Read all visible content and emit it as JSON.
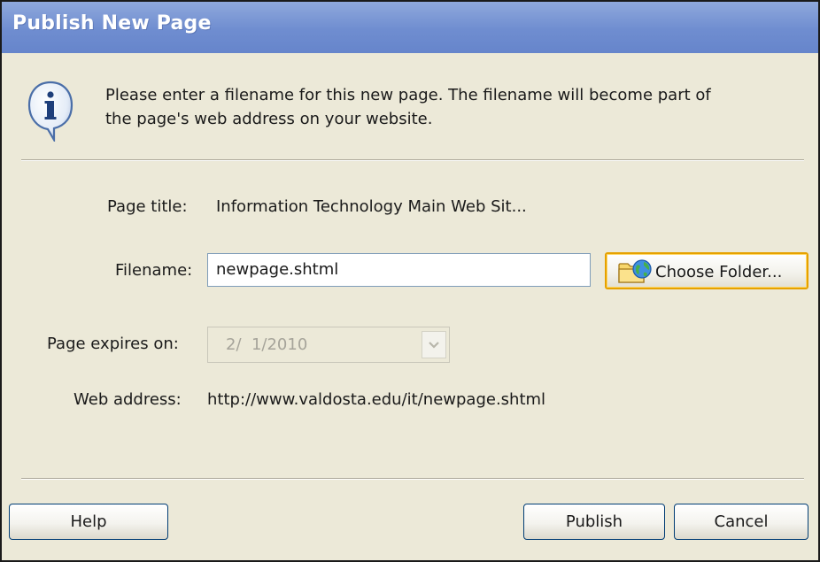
{
  "dialog": {
    "title": "Publish New Page",
    "intro_line1": "Please enter a filename for this new page. The filename will become part of",
    "intro_line2": "the page's web address on your website.",
    "info_icon": "info-icon"
  },
  "form": {
    "page_title_label": "Page title:",
    "page_title_value": "Information Technology Main Web Sit...",
    "filename_label": "Filename:",
    "filename_value": "newpage.shtml",
    "choose_folder_label": "Choose Folder...",
    "choose_folder_icon": "folder-globe-icon",
    "expires_label": "Page expires on:",
    "expires_value": "2/  1/2010",
    "web_address_label": "Web address:",
    "web_address_value": "http://www.valdosta.edu/it/newpage.shtml"
  },
  "buttons": {
    "help": "Help",
    "publish": "Publish",
    "cancel": "Cancel"
  },
  "colors": {
    "titlebar": "#7b96d6",
    "dialog_bg": "#ece9d8",
    "focus_border": "#e6a100"
  }
}
